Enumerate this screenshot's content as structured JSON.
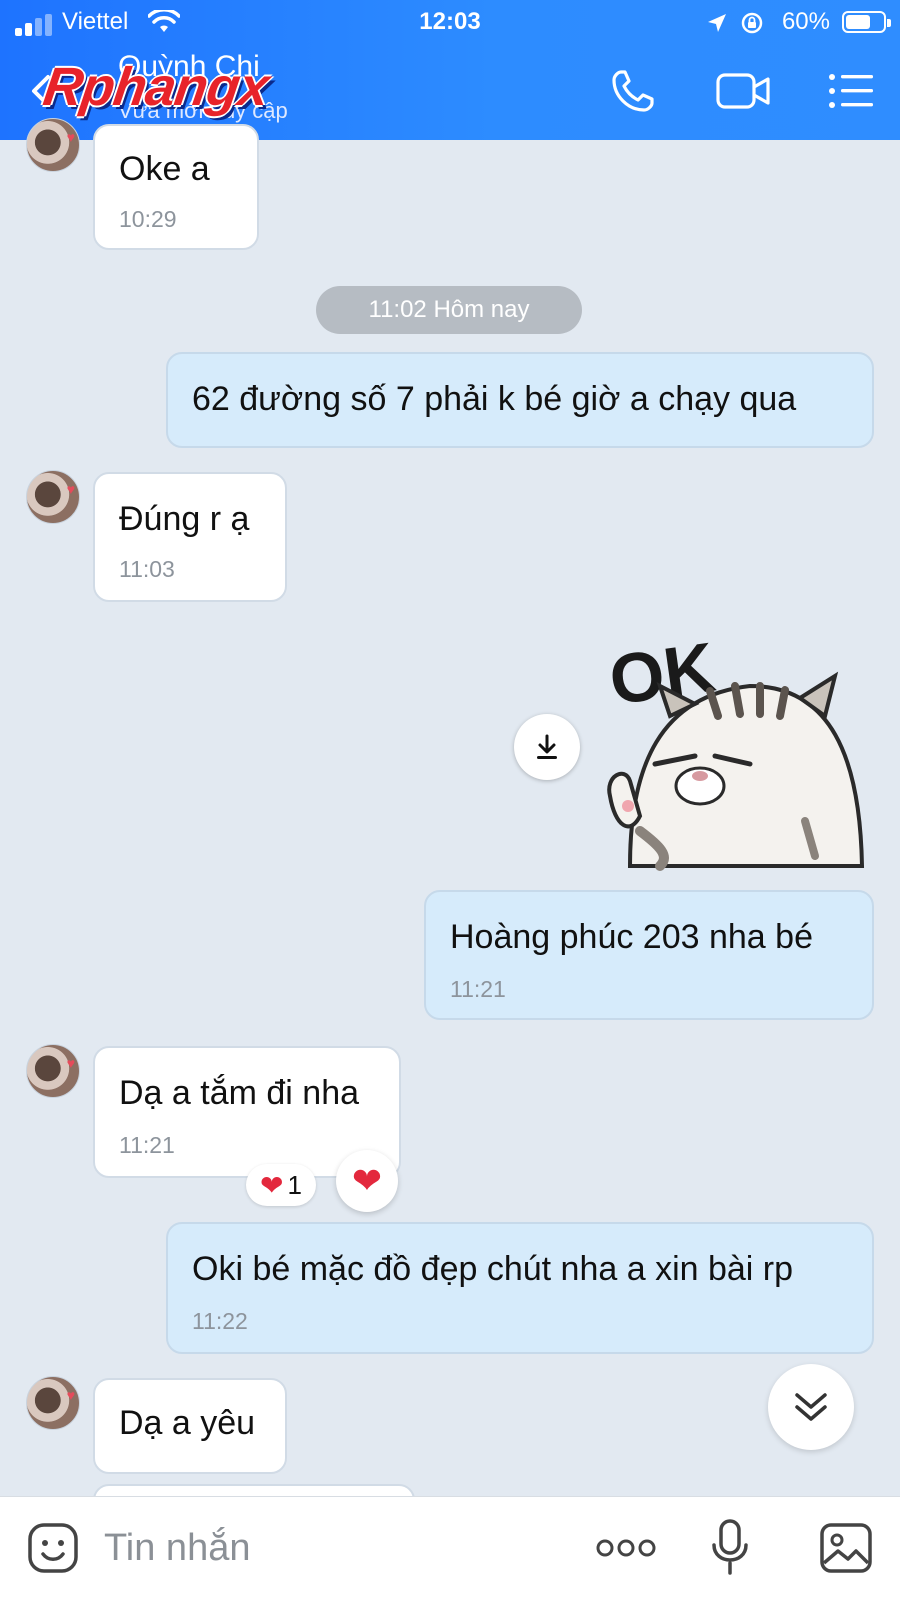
{
  "status_bar": {
    "carrier": "Viettel",
    "time": "12:03",
    "battery": "60%",
    "battery_level": 0.6,
    "signal_bars": 2
  },
  "header": {
    "contact_name": "Quỳnh Chi",
    "status": "Vừa mới truy cập",
    "watermark": "Rphangx",
    "icons": [
      "back-icon",
      "phone-icon",
      "video-call-icon",
      "menu-icon"
    ]
  },
  "messages": [
    {
      "side": "in",
      "text": "Oke a",
      "time": "10:29"
    },
    {
      "side": "out",
      "text": "62 đường số 7 phải k bé giờ a chạy qua"
    },
    {
      "side": "in",
      "text": "Đúng r ạ",
      "time": "11:03"
    },
    {
      "side": "out",
      "sticker": "OK",
      "time": ""
    },
    {
      "side": "out",
      "text": "Hoàng phúc 203 nha bé",
      "time": "11:21"
    },
    {
      "side": "in",
      "text": "Dạ a tắm đi nha",
      "time": "11:21",
      "reaction_count": "1"
    },
    {
      "side": "out",
      "text": "Oki bé mặc đồ đẹp chút nha a xin bài rp",
      "time": "11:22"
    },
    {
      "side": "in",
      "text": "Dạ a yêu"
    }
  ],
  "day_separator": "11:02 Hôm nay",
  "composer": {
    "placeholder": "Tin nhắn",
    "icons": [
      "sticker-icon",
      "more-icon",
      "microphone-icon",
      "image-icon"
    ]
  },
  "colors": {
    "header": "#2d8cff",
    "background": "#e2e9f1",
    "incoming_bubble": "#ffffff",
    "outgoing_bubble": "#d6ebfb"
  }
}
